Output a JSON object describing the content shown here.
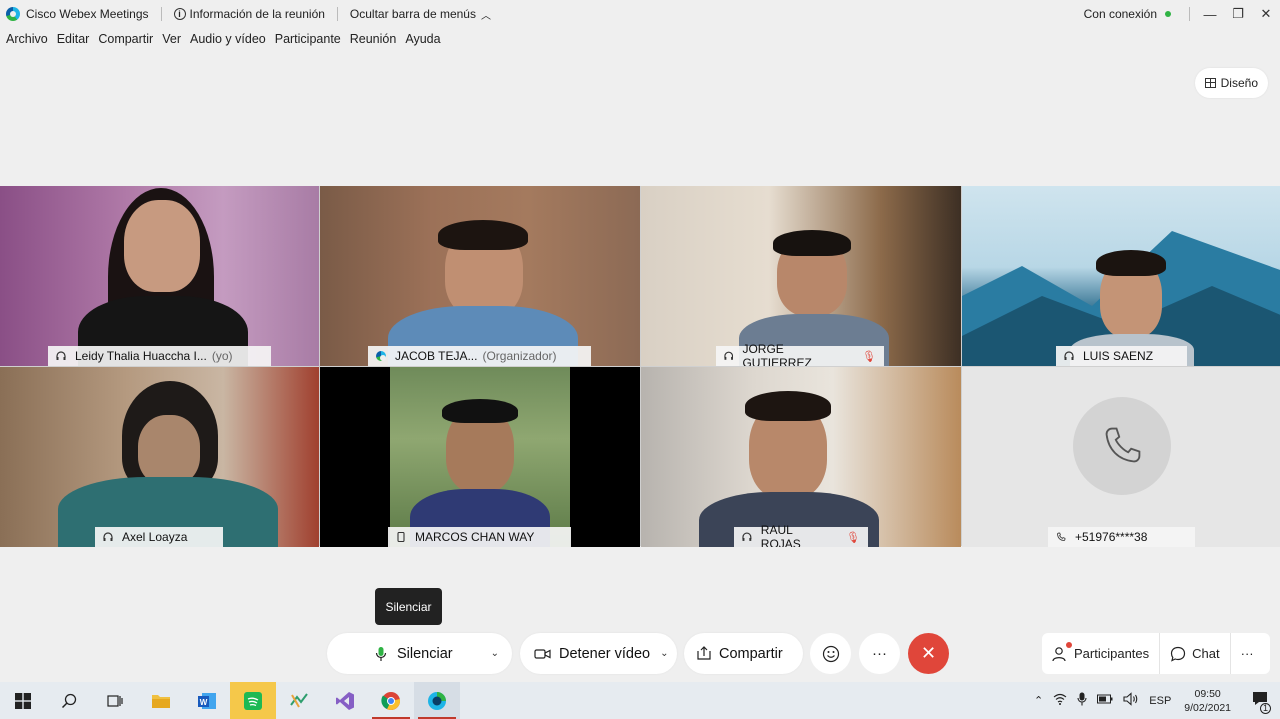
{
  "titlebar": {
    "app_name": "Cisco Webex Meetings",
    "meeting_info": "Información de la reunión",
    "hide_menu": "Ocultar barra de menús",
    "connection": "Con conexión"
  },
  "menu": [
    "Archivo",
    "Editar",
    "Compartir",
    "Ver",
    "Audio y vídeo",
    "Participante",
    "Reunión",
    "Ayuda"
  ],
  "layout_button": "Diseño",
  "participants": [
    {
      "name": "Leidy Thalia Huaccha I...",
      "suffix": "(yo)",
      "icon": "headphones-icon"
    },
    {
      "name": "JACOB TEJA...",
      "suffix": "(Organizador)",
      "icon": "webex-icon"
    },
    {
      "name": "JORGE GUTIERREZ",
      "suffix": "",
      "icon": "headphones-icon",
      "muted": true
    },
    {
      "name": "LUIS SAENZ",
      "suffix": "",
      "icon": "headphones-icon"
    },
    {
      "name": "Axel Loayza",
      "suffix": "",
      "icon": "headphones-icon"
    },
    {
      "name": "MARCOS CHAN WAY",
      "suffix": "",
      "icon": "mobile-icon"
    },
    {
      "name": "RAUL ROJAS",
      "suffix": "",
      "icon": "headphones-icon",
      "muted": true
    },
    {
      "name": "+51976****38",
      "suffix": "",
      "icon": "phone-icon"
    }
  ],
  "tooltip": "Silenciar",
  "controls": {
    "mute": "Silenciar",
    "video": "Detener vídeo",
    "share": "Compartir",
    "participants": "Participantes",
    "chat": "Chat"
  },
  "taskbar": {
    "lang": "ESP",
    "time": "09:50",
    "date": "9/02/2021",
    "notification_count": "1"
  },
  "colors": {
    "accent_green": "#2fb344",
    "leave_red": "#e0463a",
    "taskbar": "#e6ebf0"
  }
}
